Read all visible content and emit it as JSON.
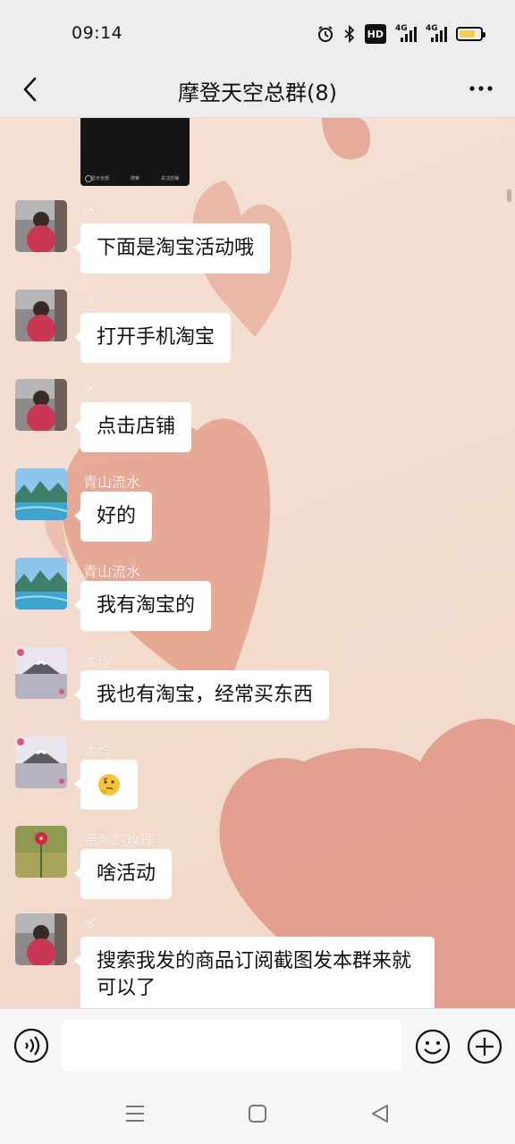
{
  "status_bar": {
    "time": "09:14",
    "hd_label": "HD",
    "network_label_1": "4G",
    "network_label_2": "4G",
    "battery_level": 0.75
  },
  "nav": {
    "title": "摩登天空总群(8)"
  },
  "video_thumb": {
    "labels": [
      "显示全部",
      "搜索",
      "关注店铺"
    ]
  },
  "messages": [
    {
      "sender": "ര്",
      "text": "下面是淘宝活动哦",
      "avatar": "avatar-girl-photo"
    },
    {
      "sender": "ര്",
      "text": "打开手机淘宝",
      "avatar": "avatar-girl-photo"
    },
    {
      "sender": "ര്",
      "text": "点击店铺",
      "avatar": "avatar-girl-photo"
    },
    {
      "sender": "青山流水",
      "text": "好的",
      "avatar": "avatar-landscape-river"
    },
    {
      "sender": "青山流水",
      "text": "我有淘宝的",
      "avatar": "avatar-landscape-river"
    },
    {
      "sender": "大玲",
      "text": "我也有淘宝，经常买东西",
      "avatar": "avatar-mount-fuji"
    },
    {
      "sender": "大玲",
      "text": "",
      "emoji": "thinking-face-emoji",
      "avatar": "avatar-mount-fuji"
    },
    {
      "sender": "带刺的玫瑰",
      "text": "啥活动",
      "avatar": "avatar-pink-flower"
    },
    {
      "sender": "ര്",
      "text": "搜索我发的商品订阅截图发本群来就可以了",
      "avatar": "avatar-girl-photo"
    }
  ],
  "input": {
    "placeholder": "",
    "value": ""
  },
  "colors": {
    "chat_bg": "#f3ddd0",
    "heart": "#e4a08c",
    "bubble": "#ffffff",
    "bar_bg": "#ededed"
  }
}
